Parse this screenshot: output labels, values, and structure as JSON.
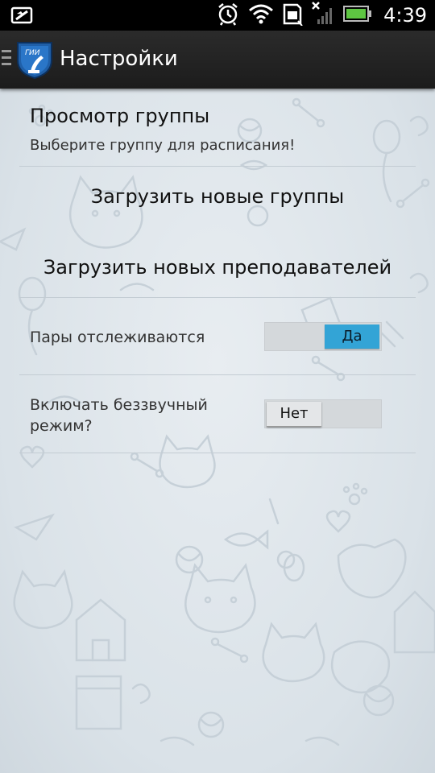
{
  "status_bar": {
    "time": "4:39",
    "icons": [
      "no-data-sim-icon",
      "alarm-icon",
      "wifi-icon",
      "sd-card-icon",
      "signal-off-icon",
      "battery-icon"
    ],
    "battery_color": "#5ec642"
  },
  "action_bar": {
    "title": "Настройки",
    "logo_text": "ГИИ",
    "logo_color": "#1f5fa8"
  },
  "settings": {
    "group_view": {
      "title": "Просмотр группы",
      "summary": "Выберите группу для расписания!"
    },
    "load_groups_label": "Загрузить новые группы",
    "load_teachers_label": "Загрузить новых преподавателей",
    "track_pairs": {
      "label": "Пары отслеживаются",
      "value": "Да",
      "on": true
    },
    "silent_mode": {
      "label_line1": "Включать беззвучный",
      "label_line2": "режим?",
      "value": "Нет",
      "on": false
    }
  },
  "colors": {
    "accent": "#33a4d6",
    "background": "#dfe5ea",
    "action_bar": "#222222"
  }
}
